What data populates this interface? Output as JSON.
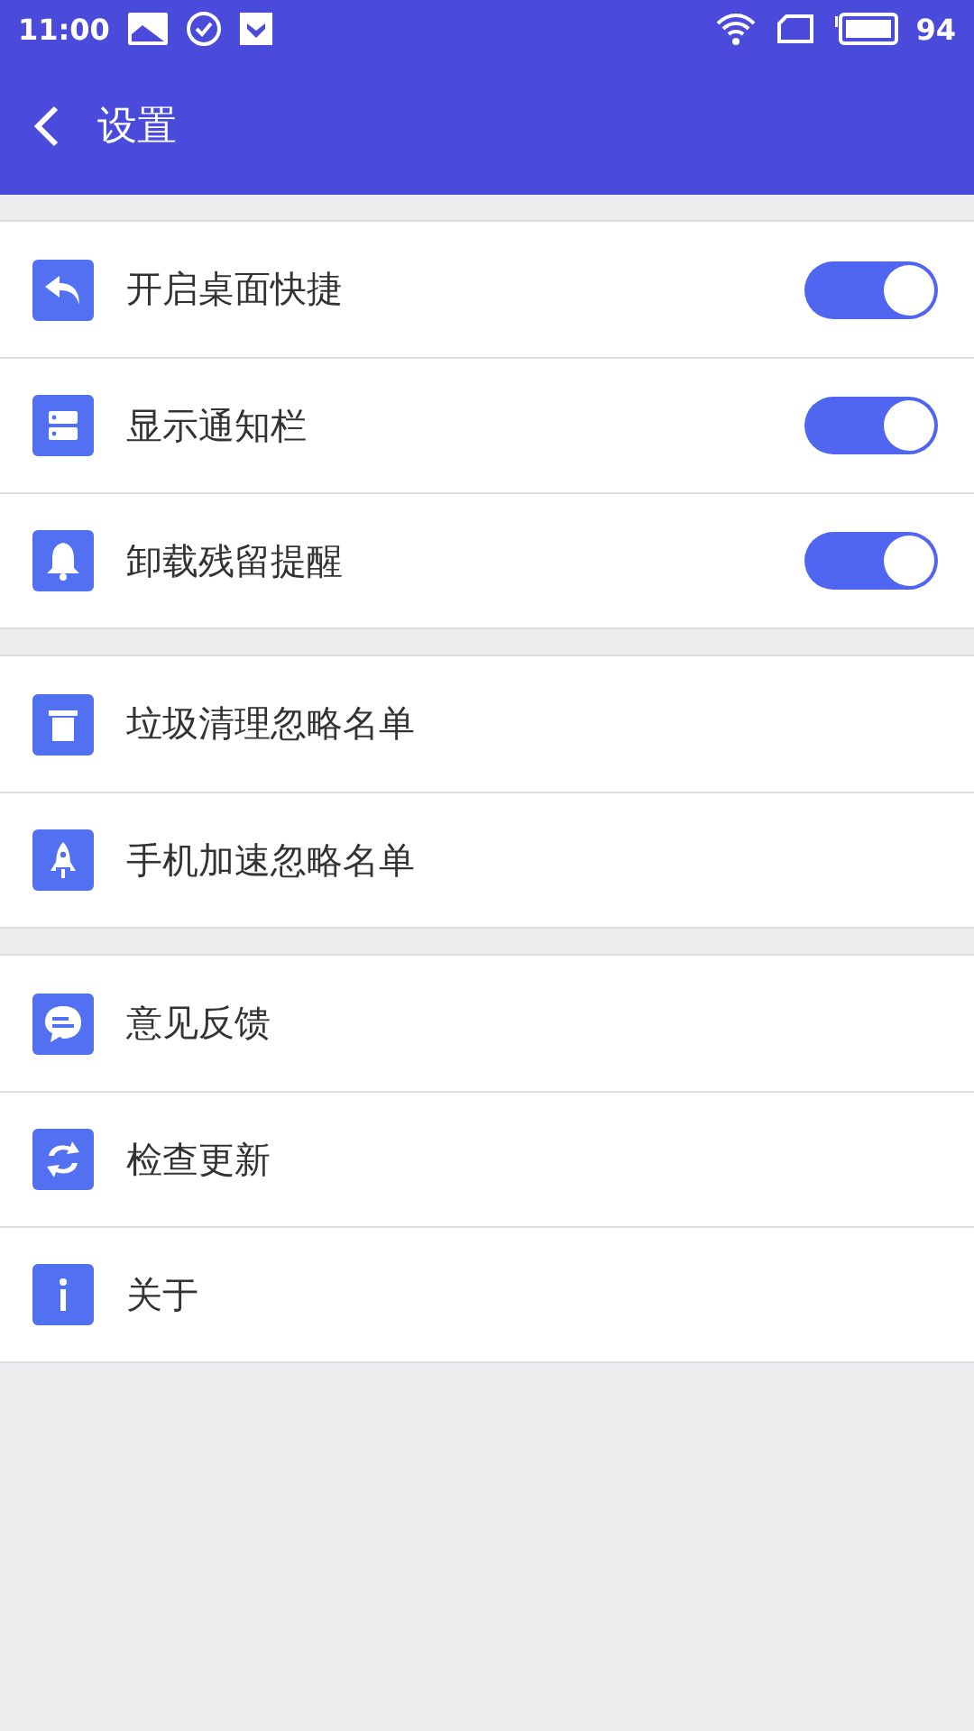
{
  "status_bar": {
    "time": "11:00",
    "battery": "94"
  },
  "app_bar": {
    "title": "设置"
  },
  "groups": [
    {
      "rows": [
        {
          "kind": "toggle",
          "label": "开启桌面快捷",
          "on": true
        },
        {
          "kind": "toggle",
          "label": "显示通知栏",
          "on": true
        },
        {
          "kind": "toggle",
          "label": "卸载残留提醒",
          "on": true
        }
      ]
    },
    {
      "rows": [
        {
          "kind": "link",
          "label": "垃圾清理忽略名单"
        },
        {
          "kind": "link",
          "label": "手机加速忽略名单"
        }
      ]
    },
    {
      "rows": [
        {
          "kind": "link",
          "label": "意见反馈"
        },
        {
          "kind": "link",
          "label": "检查更新"
        },
        {
          "kind": "link",
          "label": "关于"
        }
      ]
    }
  ]
}
